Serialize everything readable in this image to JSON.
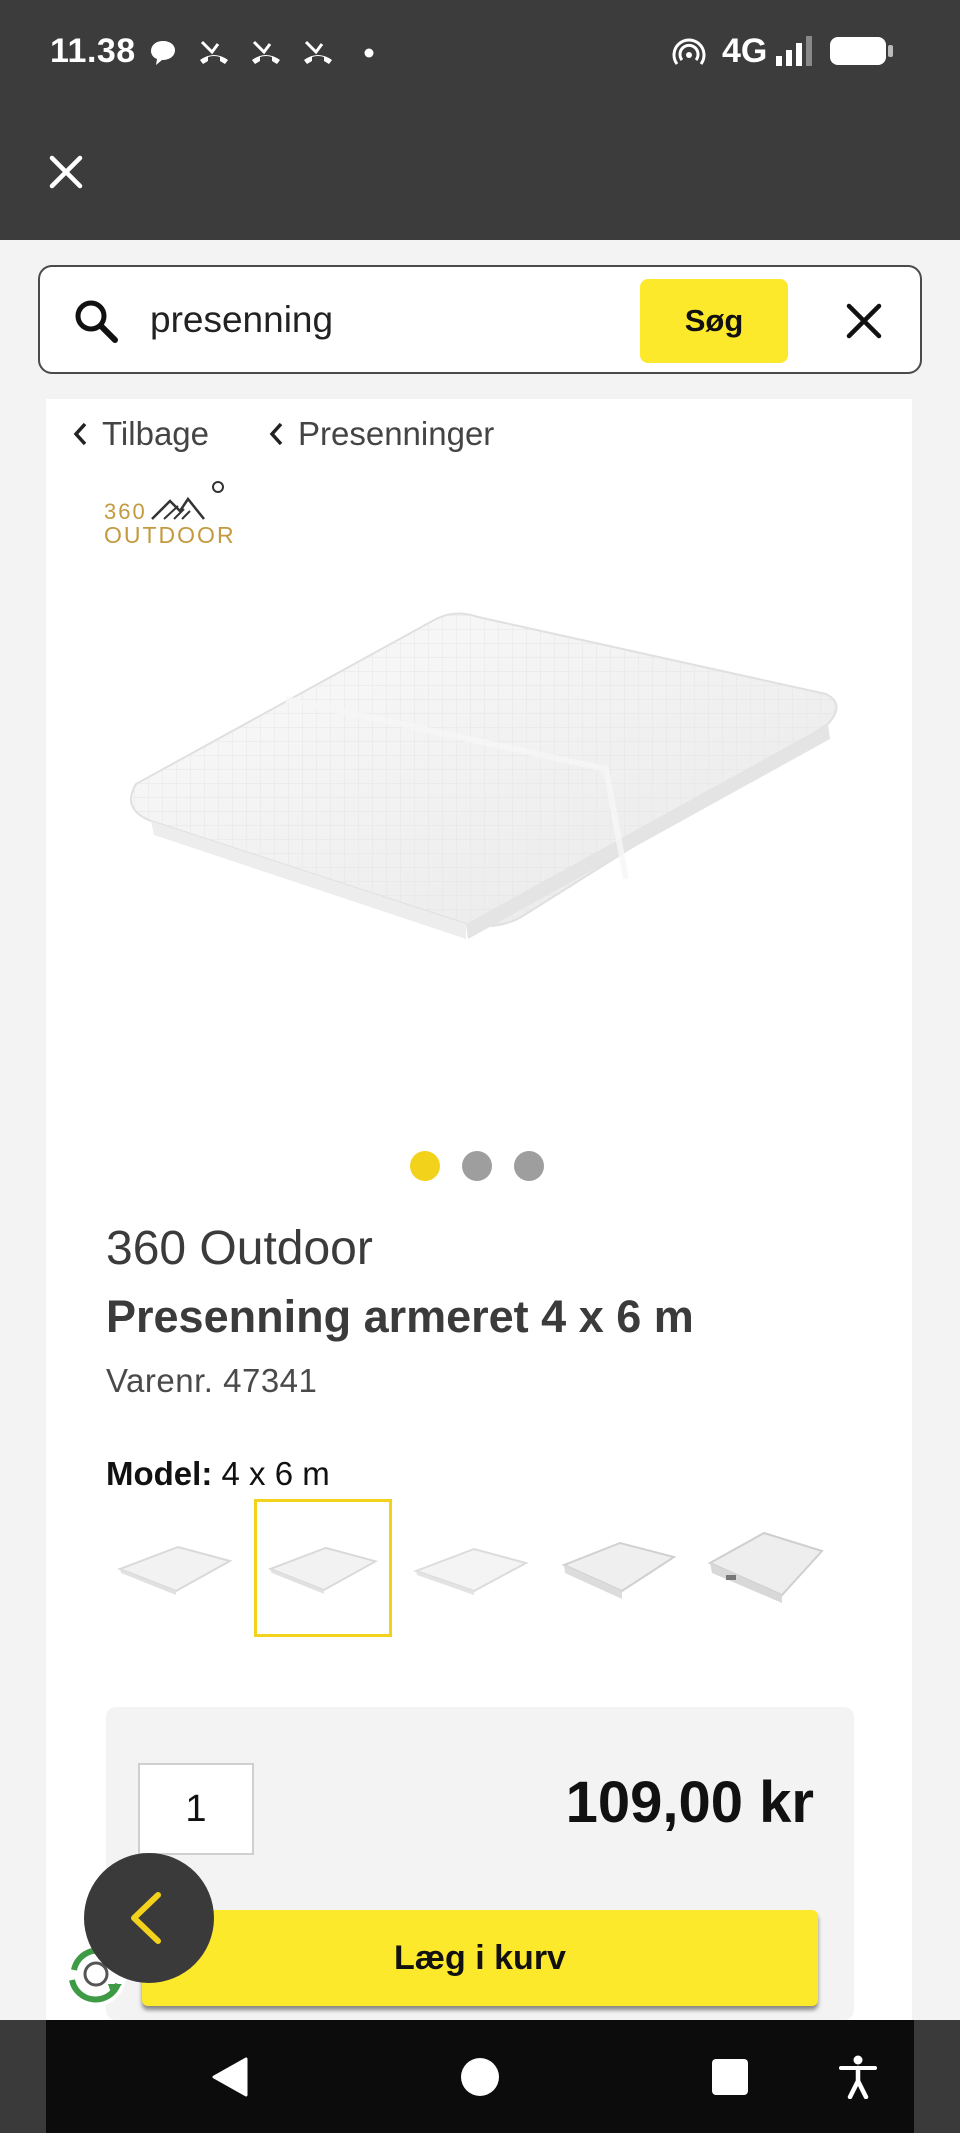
{
  "status_bar": {
    "time": "11.38",
    "network": "4G",
    "icons": [
      "chat-bubble-icon",
      "missed-call-icon",
      "missed-call-icon",
      "missed-call-icon",
      "dot-icon",
      "hotspot-icon",
      "signal-icon",
      "battery-icon"
    ]
  },
  "header": {
    "close_icon": "close-icon"
  },
  "search": {
    "value": "presenning",
    "button_label": "Søg",
    "icon": "search-icon",
    "clear_icon": "close-icon"
  },
  "breadcrumb": {
    "back_label": "Tilbage",
    "category_label": "Presenninger"
  },
  "brand_logo": {
    "line1": "360",
    "line2": "OUTDOOR"
  },
  "carousel": {
    "total": 3,
    "active_index": 0
  },
  "product": {
    "brand": "360 Outdoor",
    "title": "Presenning armeret 4 x 6 m",
    "sku": "Varenr. 47341",
    "model_label": "Model:",
    "model_value": "4 x 6 m",
    "variants_count": 5,
    "selected_variant": 1
  },
  "buy": {
    "quantity": "1",
    "price": "109,00 kr",
    "add_to_cart_label": "Læg i kurv"
  },
  "nav": {
    "icons": [
      "back-icon",
      "home-icon",
      "recents-icon",
      "accessibility-icon"
    ]
  },
  "colors": {
    "accent": "#fde92b",
    "header": "#3c3c3c",
    "text": "#3b3b3b"
  }
}
